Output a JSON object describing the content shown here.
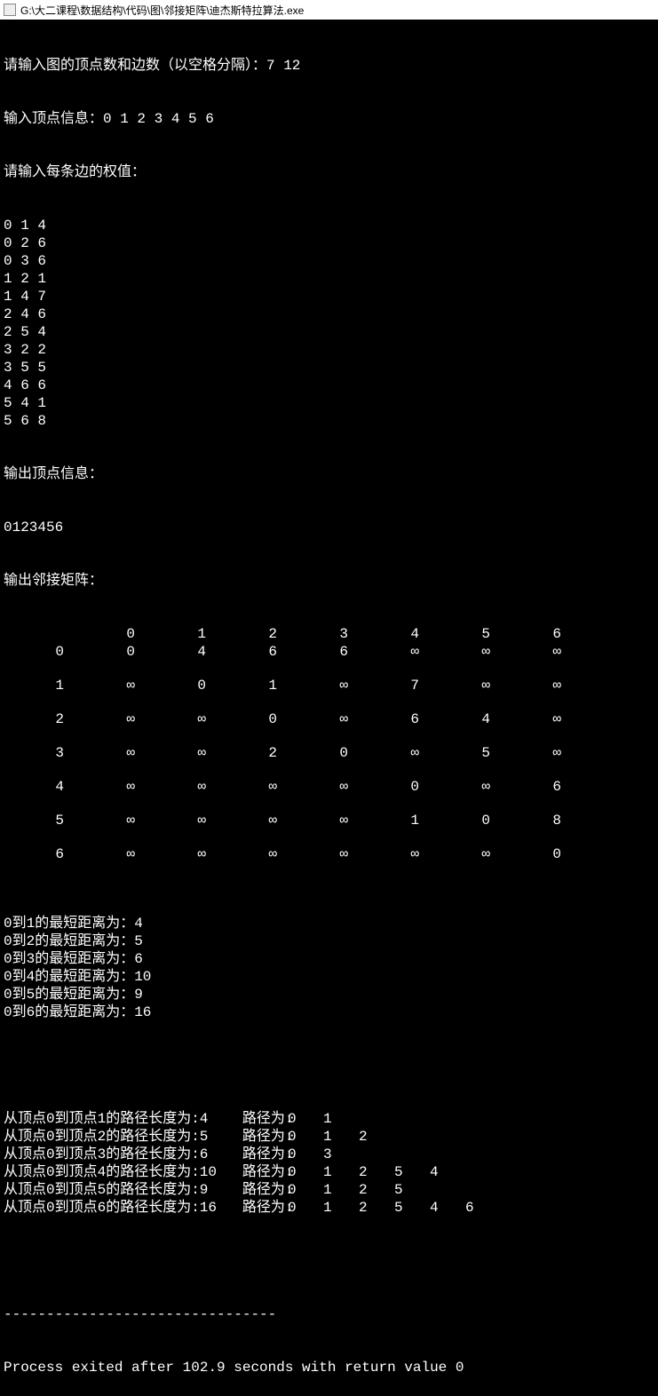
{
  "window": {
    "title": "G:\\大二课程\\数据结构\\代码\\图\\邻接矩阵\\迪杰斯特拉算法.exe"
  },
  "prompts": {
    "vertices_edges": "请输入图的顶点数和边数（以空格分隔）：7 12",
    "vertex_info": "输入顶点信息：0 1 2 3 4 5 6",
    "edge_weights": "请输入每条边的权值："
  },
  "edges": [
    "0 1 4",
    "0 2 6",
    "0 3 6",
    "1 2 1",
    "1 4 7",
    "2 4 6",
    "2 5 4",
    "3 2 2",
    "3 5 5",
    "4 6 6",
    "5 4 1",
    "5 6 8"
  ],
  "output": {
    "vertex_label": "输出顶点信息：",
    "vertex_sequence": "0123456",
    "matrix_label": "输出邻接矩阵："
  },
  "matrix": {
    "headers": [
      "0",
      "1",
      "2",
      "3",
      "4",
      "5",
      "6"
    ],
    "rows": [
      {
        "label": "0",
        "cells": [
          "0",
          "4",
          "6",
          "6",
          "∞",
          "∞",
          "∞"
        ]
      },
      {
        "label": "1",
        "cells": [
          "∞",
          "0",
          "1",
          "∞",
          "7",
          "∞",
          "∞"
        ]
      },
      {
        "label": "2",
        "cells": [
          "∞",
          "∞",
          "0",
          "∞",
          "6",
          "4",
          "∞"
        ]
      },
      {
        "label": "3",
        "cells": [
          "∞",
          "∞",
          "2",
          "0",
          "∞",
          "5",
          "∞"
        ]
      },
      {
        "label": "4",
        "cells": [
          "∞",
          "∞",
          "∞",
          "∞",
          "0",
          "∞",
          "6"
        ]
      },
      {
        "label": "5",
        "cells": [
          "∞",
          "∞",
          "∞",
          "∞",
          "1",
          "0",
          "8"
        ]
      },
      {
        "label": "6",
        "cells": [
          "∞",
          "∞",
          "∞",
          "∞",
          "∞",
          "∞",
          "0"
        ]
      }
    ]
  },
  "shortest": [
    "0到1的最短距离为：4",
    "0到2的最短距离为：5",
    "0到3的最短距离为：6",
    "0到4的最短距离为：10",
    "0到5的最短距离为：9",
    "0到6的最短距离为：16"
  ],
  "paths": [
    {
      "prefix": "从顶点0到顶点1的路径长度为:4    路径为:",
      "nodes": [
        "0",
        "1"
      ]
    },
    {
      "prefix": "从顶点0到顶点2的路径长度为:5    路径为:",
      "nodes": [
        "0",
        "1",
        "2"
      ]
    },
    {
      "prefix": "从顶点0到顶点3的路径长度为:6    路径为:",
      "nodes": [
        "0",
        "3"
      ]
    },
    {
      "prefix": "从顶点0到顶点4的路径长度为:10   路径为:",
      "nodes": [
        "0",
        "1",
        "2",
        "5",
        "4"
      ]
    },
    {
      "prefix": "从顶点0到顶点5的路径长度为:9    路径为:",
      "nodes": [
        "0",
        "1",
        "2",
        "5"
      ]
    },
    {
      "prefix": "从顶点0到顶点6的路径长度为:16   路径为:",
      "nodes": [
        "0",
        "1",
        "2",
        "5",
        "4",
        "6"
      ]
    }
  ],
  "separator": "--------------------------------",
  "exit_msg": "Process exited after 102.9 seconds with return value 0"
}
